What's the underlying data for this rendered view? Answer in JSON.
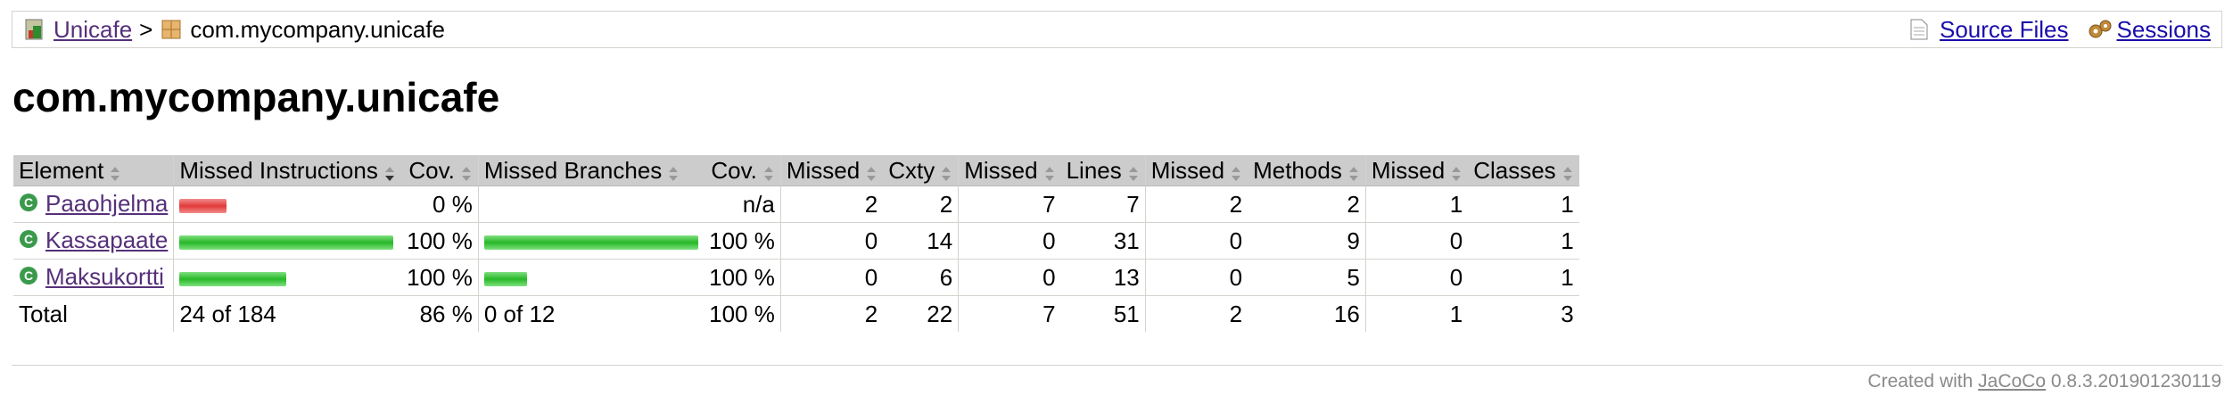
{
  "breadcrumb": {
    "report_link": "Unicafe",
    "separator": ">",
    "package_name": "com.mycompany.unicafe",
    "source_files_link": "Source Files",
    "sessions_link": "Sessions"
  },
  "page_title": "com.mycompany.unicafe",
  "table": {
    "headers": {
      "element": "Element",
      "missed_instructions": "Missed Instructions",
      "cov1": "Cov.",
      "missed_branches": "Missed Branches",
      "cov2": "Cov.",
      "missed_cxty": "Missed",
      "cxty": "Cxty",
      "missed_lines": "Missed",
      "lines": "Lines",
      "missed_methods": "Missed",
      "methods": "Methods",
      "missed_classes": "Missed",
      "classes": "Classes"
    },
    "rows": [
      {
        "name": "Paaohjelma",
        "instr_cov": "0 %",
        "branch_cov": "n/a",
        "missed_cxty": "2",
        "cxty": "2",
        "missed_lines": "7",
        "lines": "7",
        "missed_methods": "2",
        "methods": "2",
        "missed_classes": "1",
        "classes": "1",
        "instr_covered_fraction": 0.0,
        "instr_missed_fraction": 0.22,
        "branch_fraction": 0
      },
      {
        "name": "Kassapaate",
        "instr_cov": "100 %",
        "branch_cov": "100 %",
        "missed_cxty": "0",
        "cxty": "14",
        "missed_lines": "0",
        "lines": "31",
        "missed_methods": "0",
        "methods": "9",
        "missed_classes": "0",
        "classes": "1",
        "instr_covered_fraction": 1.0,
        "instr_missed_fraction": 0,
        "branch_fraction": 1.0
      },
      {
        "name": "Maksukortti",
        "instr_cov": "100 %",
        "branch_cov": "100 %",
        "missed_cxty": "0",
        "cxty": "6",
        "missed_lines": "0",
        "lines": "13",
        "missed_methods": "0",
        "methods": "5",
        "missed_classes": "0",
        "classes": "1",
        "instr_covered_fraction": 0.5,
        "instr_missed_fraction": 0,
        "branch_fraction": 0.2
      }
    ],
    "total": {
      "label": "Total",
      "instructions": "24 of 184",
      "instr_cov": "86 %",
      "branches": "0 of 12",
      "branch_cov": "100 %",
      "missed_cxty": "2",
      "cxty": "22",
      "missed_lines": "7",
      "lines": "51",
      "missed_methods": "2",
      "methods": "16",
      "missed_classes": "1",
      "classes": "3"
    }
  },
  "footer": {
    "prefix": "Created with",
    "link": "JaCoCo",
    "version": "0.8.3.201901230119"
  },
  "colors": {
    "covered": "#27b827",
    "missed": "#e23a3a",
    "header_bg": "#cccccc"
  }
}
